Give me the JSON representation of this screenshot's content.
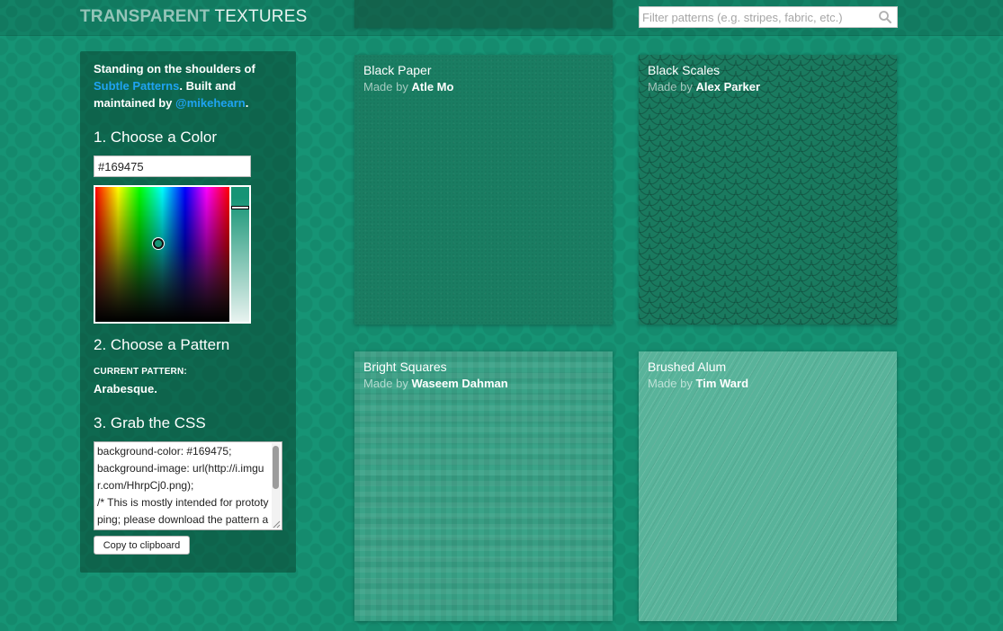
{
  "brand": {
    "logo_part1": "TRANSPARENT",
    "logo_part2": "TEXTURES",
    "page_background": "#169475"
  },
  "search": {
    "placeholder": "Filter patterns (e.g. stripes, fabric, etc.)",
    "value": "",
    "icon": "search-icon"
  },
  "sidebar": {
    "intro_prefix": "Standing on the shoulders of ",
    "intro_link1": "Subtle Patterns",
    "intro_middle": ". Built and maintained by ",
    "intro_link2": "@mikehearn",
    "intro_suffix": ".",
    "link_color": "#1fa3f2",
    "step1_heading": "1. Choose a Color",
    "color_value": "#169475",
    "step2_heading": "2. Choose a Pattern",
    "current_pattern_label": "CURRENT PATTERN:",
    "current_pattern_value": "Arabesque.",
    "step3_heading": "3. Grab the CSS",
    "css_text": "background-color: #169475;\nbackground-image: url(http://i.imgur.com/HhrpCj0.png);\n/* This is mostly intended for prototyping; please download the pattern and re-host for production environments. Thank you! */",
    "copy_button": "Copy to clipboard"
  },
  "made_by_prefix": "Made by",
  "patterns": [
    {
      "name": "Black Paper",
      "author": "Atle Mo"
    },
    {
      "name": "Black Scales",
      "author": "Alex Parker"
    },
    {
      "name": "Bright Squares",
      "author": "Waseem Dahman"
    },
    {
      "name": "Brushed Alum",
      "author": "Tim Ward"
    }
  ]
}
